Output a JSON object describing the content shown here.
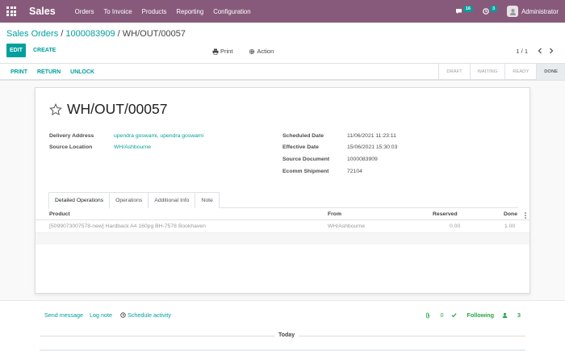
{
  "navbar": {
    "app_name": "Sales",
    "menu": [
      "Orders",
      "To Invoice",
      "Products",
      "Reporting",
      "Configuration"
    ],
    "messages_count": "16",
    "activities_count": "3",
    "user_name": "Administrator",
    "icons": [
      "apps-grid-icon",
      "chat-icon",
      "clock-icon",
      "avatar-icon"
    ]
  },
  "breadcrumb": {
    "item1": "Sales Orders",
    "sep": "/",
    "item2": "1000083909",
    "current": "WH/OUT/00057"
  },
  "control_panel": {
    "edit_label": "EDIT",
    "create_label": "CREATE",
    "print_label": "Print",
    "action_label": "Action",
    "pager": "1 / 1"
  },
  "statusbar": {
    "buttons": [
      "PRINT",
      "RETURN",
      "UNLOCK"
    ],
    "stages": [
      "DRAFT",
      "WAITING",
      "READY",
      "DONE"
    ],
    "active_stage": "DONE"
  },
  "record": {
    "title": "WH/OUT/00057",
    "left_fields": [
      {
        "label": "Delivery Address",
        "value": "upendra goswami, upendra goswami"
      },
      {
        "label": "Source Location",
        "value": "WH/Ashbourne"
      }
    ],
    "right_fields": [
      {
        "label": "Scheduled Date",
        "value": "11/06/2021 11:23:11"
      },
      {
        "label": "Effective Date",
        "value": "15/06/2021 15:30:03"
      },
      {
        "label": "Source Document",
        "value": "1000083909"
      },
      {
        "label": "Ecomm Shipment",
        "value": "72104"
      }
    ]
  },
  "tabs": [
    "Detailed Operations",
    "Operations",
    "Additional Info",
    "Note"
  ],
  "table": {
    "headers": [
      "Product",
      "From",
      "Reserved",
      "Done"
    ],
    "rows": [
      {
        "product": "[5099073007578-new] Hardback A4 160pg BH-7578 Bookhaven",
        "from": "WH/Ashbourne",
        "reserved": "0.00",
        "done": "1.00"
      }
    ]
  },
  "chatter": {
    "send_message": "Send message",
    "log_note": "Log note",
    "schedule_activity": "Schedule activity",
    "attachments": "0",
    "following": "Following",
    "followers": "3",
    "today": "Today"
  },
  "colors": {
    "brand": "#875a7b",
    "accent": "#00a09d"
  }
}
